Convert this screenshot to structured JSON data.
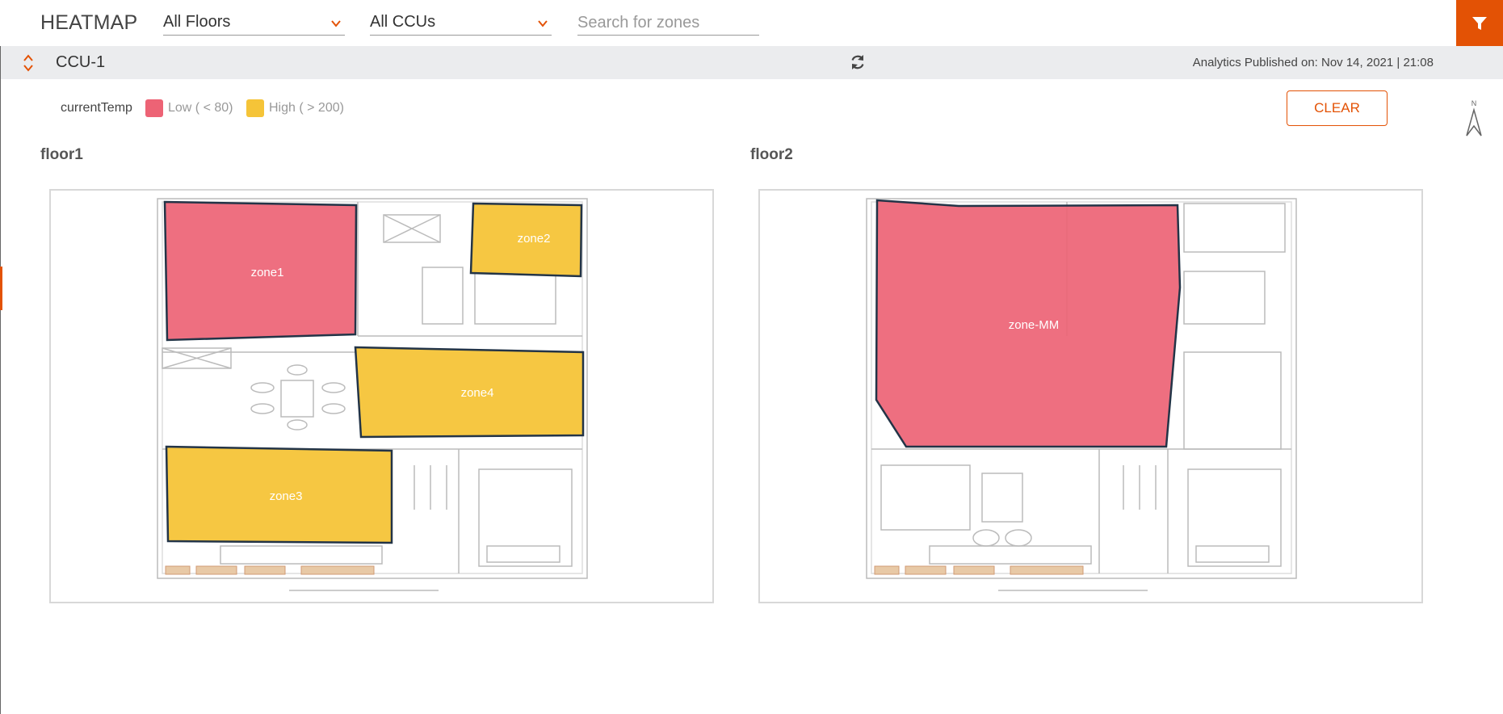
{
  "header": {
    "title": "HEATMAP",
    "floor_select": "All Floors",
    "ccu_select": "All CCUs",
    "search_placeholder": "Search for zones",
    "filter_icon": "filter-icon"
  },
  "ccu_bar": {
    "name": "CCU-1",
    "published": "Analytics Published on: Nov 14, 2021 | 21:08"
  },
  "legend": {
    "metric": "currentTemp",
    "items": [
      {
        "label": "Low ( < 80)",
        "color": "#ed6375"
      },
      {
        "label": "High ( > 200)",
        "color": "#f5c438"
      }
    ],
    "clear_label": "CLEAR",
    "north_label": "N"
  },
  "colors": {
    "accent": "#e35205",
    "low": "#ed6375",
    "high": "#f5c438"
  },
  "floors": [
    {
      "name": "floor1",
      "zones": [
        {
          "name": "zone1",
          "level": "low"
        },
        {
          "name": "zone2",
          "level": "high"
        },
        {
          "name": "zone4",
          "level": "high"
        },
        {
          "name": "zone3",
          "level": "high"
        }
      ]
    },
    {
      "name": "floor2",
      "zones": [
        {
          "name": "zone-MM",
          "level": "low"
        }
      ]
    }
  ]
}
